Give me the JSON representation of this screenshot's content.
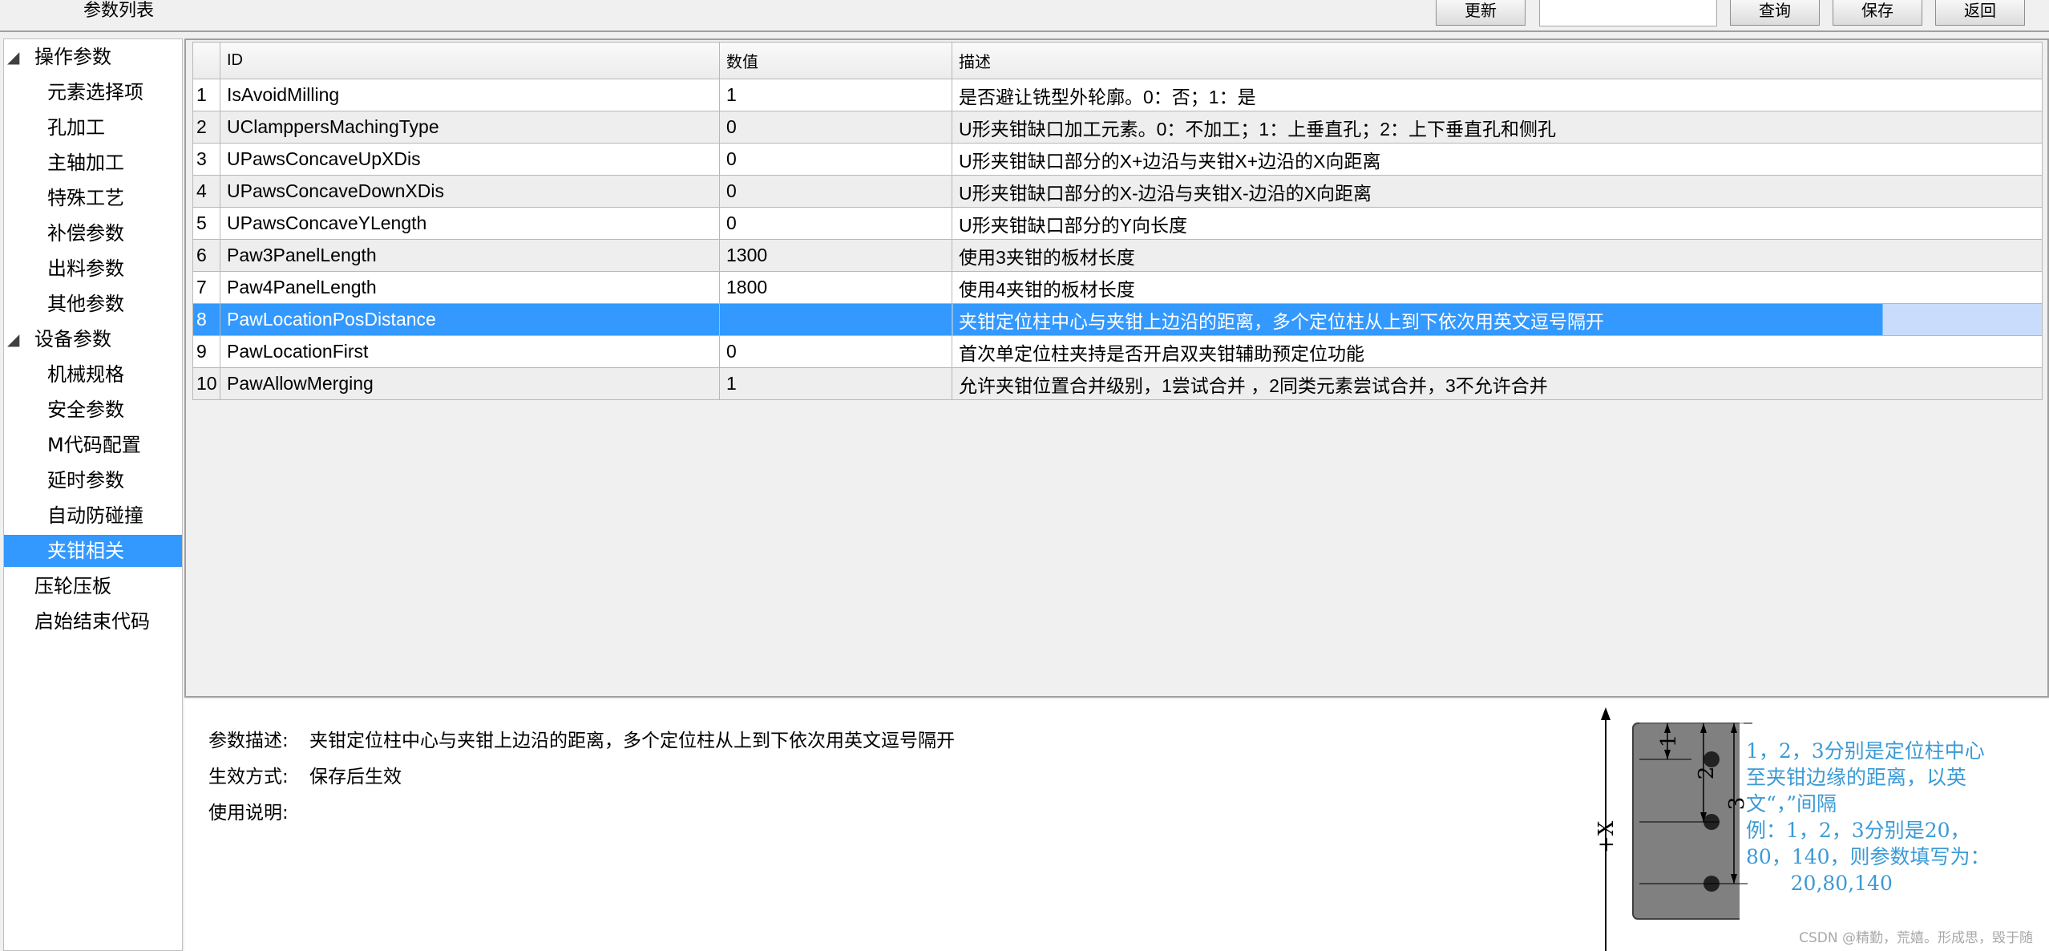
{
  "window": {
    "title": "参数列表"
  },
  "toolbar": {
    "refresh_label": "更新",
    "search_value": "",
    "query_label": "查询",
    "save_label": "保存",
    "back_label": "返回"
  },
  "tree": {
    "groups": [
      {
        "label": "操作参数",
        "children": [
          "元素选择项",
          "孔加工",
          "主轴加工",
          "特殊工艺",
          "补偿参数",
          "出料参数",
          "其他参数"
        ]
      },
      {
        "label": "设备参数",
        "children": [
          "机械规格",
          "安全参数",
          "M代码配置",
          "延时参数",
          "自动防碰撞",
          "夹钳相关"
        ]
      }
    ],
    "top_items": [
      "压轮压板",
      "启始结束代码"
    ],
    "selected": "夹钳相关"
  },
  "grid": {
    "columns": [
      "",
      "ID",
      "数值",
      "描述"
    ],
    "rows": [
      [
        "1",
        "IsAvoidMilling",
        "1",
        "是否避让铣型外轮廓。0：否；1：是"
      ],
      [
        "2",
        "UClamppersMachingType",
        "0",
        "U形夹钳缺口加工元素。0：不加工；1：上垂直孔；2：上下垂直孔和侧孔"
      ],
      [
        "3",
        "UPawsConcaveUpXDis",
        "0",
        "U形夹钳缺口部分的X+边沿与夹钳X+边沿的X向距离"
      ],
      [
        "4",
        "UPawsConcaveDownXDis",
        "0",
        "U形夹钳缺口部分的X-边沿与夹钳X-边沿的X向距离"
      ],
      [
        "5",
        "UPawsConcaveYLength",
        "0",
        "U形夹钳缺口部分的Y向长度"
      ],
      [
        "6",
        "Paw3PanelLength",
        "1300",
        "使用3夹钳的板材长度"
      ],
      [
        "7",
        "Paw4PanelLength",
        "1800",
        "使用4夹钳的板材长度"
      ],
      [
        "8",
        "PawLocationPosDistance",
        "",
        "夹钳定位柱中心与夹钳上边沿的距离，多个定位柱从上到下依次用英文逗号隔开"
      ],
      [
        "9",
        "PawLocationFirst",
        "0",
        "首次单定位柱夹持是否开启双夹钳辅助预定位功能"
      ],
      [
        "10",
        "PawAllowMerging",
        "1",
        "允许夹钳位置合并级别，1尝试合并 ，2同类元素尝试合并，3不允许合并"
      ]
    ],
    "selected_row": 8
  },
  "detail": {
    "desc_label": "参数描述:",
    "desc_value": "夹钳定位柱中心与夹钳上边沿的距离，多个定位柱从上到下依次用英文逗号隔开",
    "effect_label": "生效方式:",
    "effect_value": "保存后生效",
    "usage_label": "使用说明:"
  },
  "diagram": {
    "axis_label": "+X",
    "dims": [
      "1",
      "2",
      "3"
    ],
    "note_lines": [
      "1，2，3分别是定位柱中心",
      "至夹钳边缘的距离，以英",
      "文“，”间隔",
      "例：1，2，3分别是20，",
      "80，140，则参数填写为：",
      "       20,80,140"
    ],
    "note_color": "#3b9ad6"
  },
  "watermark": "CSDN @精勤，荒嬉。形成思，毁于随"
}
